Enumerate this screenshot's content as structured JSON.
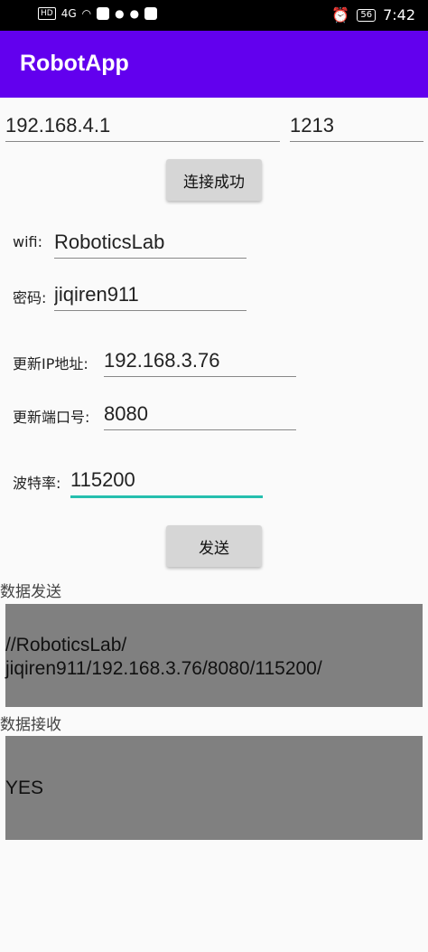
{
  "status_bar": {
    "network": "HD",
    "signal": "4G",
    "battery": "56",
    "time": "7:42"
  },
  "app_bar": {
    "title": "RobotApp"
  },
  "connection": {
    "ip_value": "192.168.4.1",
    "port_value": "1213",
    "connect_button": "连接成功"
  },
  "form": {
    "wifi_label": "wifi:",
    "wifi_value": "RoboticsLab",
    "password_label": "密码:",
    "password_value": "jiqiren911",
    "new_ip_label": "更新IP地址:",
    "new_ip_value": "192.168.3.76",
    "new_port_label": "更新端口号:",
    "new_port_value": "8080",
    "baud_label": "波特率:",
    "baud_value": "115200",
    "send_button": "发送"
  },
  "send_section": {
    "label": "数据发送",
    "line1": "//RoboticsLab/",
    "line2": "jiqiren911/192.168.3.76/8080/115200/"
  },
  "receive_section": {
    "label": "数据接收",
    "text": "YES"
  },
  "colors": {
    "app_bar": "#6200ee",
    "focus_underline": "#26bfae",
    "panel": "#808080"
  }
}
